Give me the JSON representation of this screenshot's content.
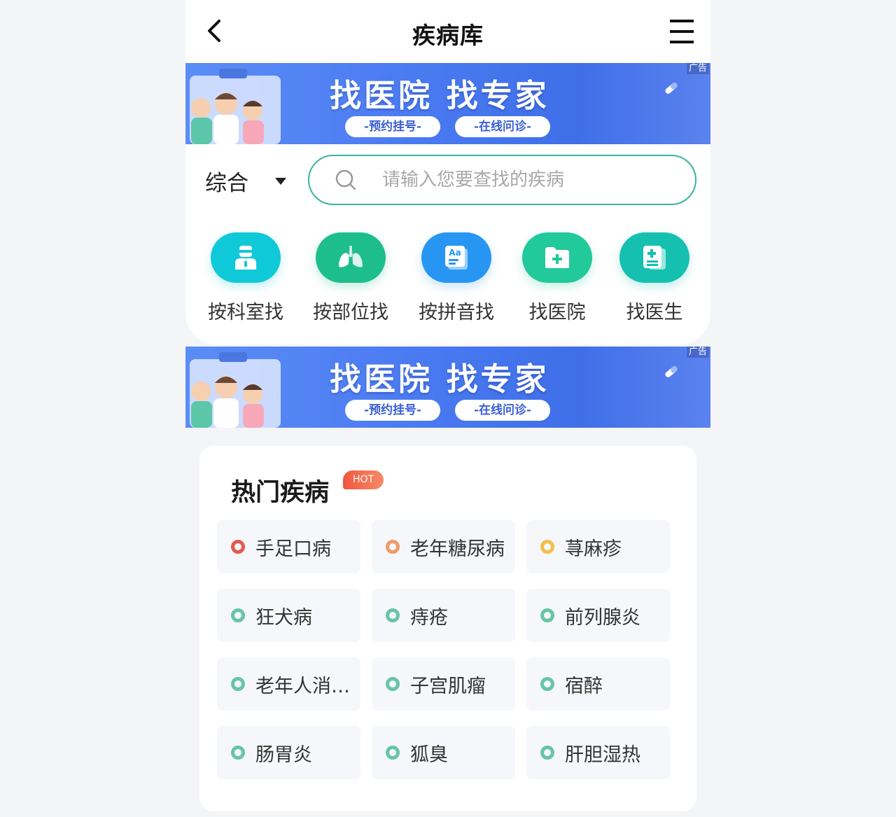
{
  "header": {
    "title": "疾病库"
  },
  "banner": {
    "ad_label": "广告",
    "title": "找医院 找专家",
    "pill_left": "-预约挂号-",
    "pill_right": "-在线问诊-",
    "colors": {
      "start": "#5b8df6",
      "end": "#3f6fe8"
    }
  },
  "search": {
    "category": "综合",
    "placeholder": "请输入您要查找的疾病",
    "border_color": "#38b59a"
  },
  "quick_nav": [
    {
      "label": "按科室找",
      "icon": "doctor-icon",
      "color": "#10c9d8"
    },
    {
      "label": "按部位找",
      "icon": "lungs-icon",
      "color": "#1ebd8c"
    },
    {
      "label": "按拼音找",
      "icon": "pinyin-card-icon",
      "color": "#2796f2"
    },
    {
      "label": "找医院",
      "icon": "hospital-folder-icon",
      "color": "#22c99a"
    },
    {
      "label": "找医生",
      "icon": "medical-record-icon",
      "color": "#15c0b0"
    }
  ],
  "hot": {
    "title": "热门疾病",
    "badge": "HOT",
    "items": [
      {
        "name": "手足口病",
        "dot": "#e45a4f"
      },
      {
        "name": "老年糖尿病",
        "dot": "#f19a6a"
      },
      {
        "name": "荨麻疹",
        "dot": "#f1c04a"
      },
      {
        "name": "狂犬病",
        "dot": "#68c5a5"
      },
      {
        "name": "痔疮",
        "dot": "#68c5a5"
      },
      {
        "name": "前列腺炎",
        "dot": "#68c5a5"
      },
      {
        "name": "老年人消…",
        "dot": "#68c5a5"
      },
      {
        "name": "子宫肌瘤",
        "dot": "#68c5a5"
      },
      {
        "name": "宿醉",
        "dot": "#68c5a5"
      },
      {
        "name": "肠胃炎",
        "dot": "#68c5a5"
      },
      {
        "name": "狐臭",
        "dot": "#68c5a5"
      },
      {
        "name": "肝胆湿热",
        "dot": "#68c5a5"
      }
    ]
  }
}
